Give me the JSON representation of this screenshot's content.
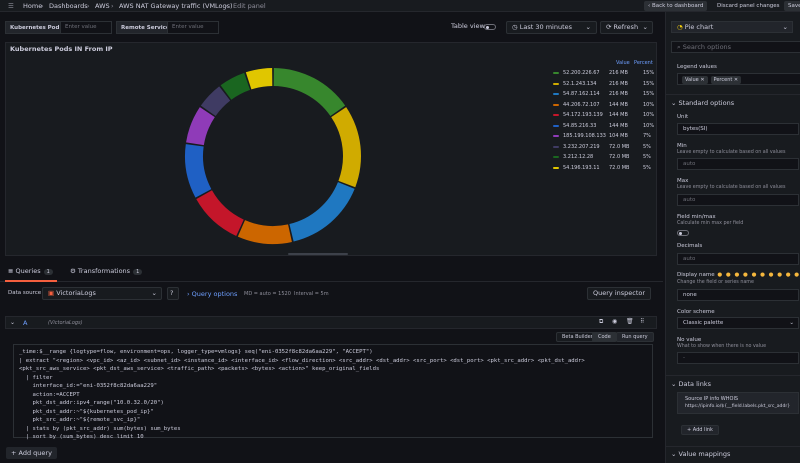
{
  "breadcrumb": {
    "home": "Home",
    "dashboards": "Dashboards",
    "folder": "AWS",
    "dashboard": "AWS NAT Gateway traffic (VMLogs)",
    "current": "Edit panel"
  },
  "topbar": {
    "back": "Back to dashboard",
    "discard": "Discard panel changes",
    "save": "Save"
  },
  "variables": [
    {
      "label": "Kubernetes Pod IP",
      "placeholder": "Enter value"
    },
    {
      "label": "Remote Service IP",
      "placeholder": "Enter value"
    }
  ],
  "toolbar": {
    "table_view": "Table view",
    "time_range": "Last 30 minutes",
    "refresh": "Refresh"
  },
  "panel": {
    "title": "Kubernetes Pods IN From IP",
    "legend_headers": {
      "value": "Value",
      "percent": "Percent"
    }
  },
  "chart_data": {
    "type": "pie",
    "donut": true,
    "slices": [
      {
        "name": "52.200.226.67",
        "value": "216 MB",
        "percent": 15,
        "color": "#37872d"
      },
      {
        "name": "52.1.243.134",
        "value": "216 MB",
        "percent": 15,
        "color": "#d0ab00"
      },
      {
        "name": "54.87.162.114",
        "value": "216 MB",
        "percent": 15,
        "color": "#1f78c1"
      },
      {
        "name": "44.206.72.107",
        "value": "144 MB",
        "percent": 10,
        "color": "#cc6600"
      },
      {
        "name": "54.172.193.139",
        "value": "144 MB",
        "percent": 10,
        "color": "#c4162a"
      },
      {
        "name": "54.85.216.33",
        "value": "144 MB",
        "percent": 10,
        "color": "#1f60c4"
      },
      {
        "name": "185.199.108.133",
        "value": "104 MB",
        "percent": 7,
        "color": "#8f3bb8"
      },
      {
        "name": "3.232.207.219",
        "value": "72.0 MB",
        "percent": 5,
        "color": "#3f3b63"
      },
      {
        "name": "3.212.12.28",
        "value": "72.0 MB",
        "percent": 5,
        "color": "#1a6620"
      },
      {
        "name": "54.196.193.11",
        "value": "72.0 MB",
        "percent": 5,
        "color": "#e0c600"
      }
    ]
  },
  "query_tabs": {
    "queries": "Queries",
    "queries_count": "1",
    "transformations": "Transformations",
    "transformations_count": "1"
  },
  "datasource": {
    "label": "Data source",
    "name": "VictoriaLogs",
    "query_options": "Query options",
    "meta": "MD = auto = 1520",
    "interval": "Interval = 5m",
    "inspector": "Query inspector"
  },
  "query": {
    "ref": "A",
    "ds": "(VictoriaLogs)",
    "builder": "Beta Builder",
    "code": "Code",
    "run": "Run query",
    "lines": [
      "_time:$__range {logtype=flow, environment=ops, logger_type=vmlogs} seq(\"eni-0352f8c82da6aa229\", \"ACCEPT\")",
      "| extract \"<region> <vpc_id> <az_id> <subnet_id> <instance_id> <interface_id> <flow_direction> <src_addr> <dst_addr> <src_port> <dst_port> <pkt_src_addr> <pkt_dst_addr>",
      "<pkt_src_aws_service> <pkt_dst_aws_service> <traffic_path> <packets> <bytes> <action>\" keep_original_fields",
      "  | filter",
      "    interface_id:=\"eni-0352f8c82da6aa229\"",
      "    action:=ACCEPT",
      "    pkt_dst_addr:ipv4_range(\"10.0.32.0/20\")",
      "    pkt_dst_addr:~\"${kubernetes_pod_ip}\"",
      "    pkt_src_addr:~\"${remote_svc_ip}\"",
      "  | stats by (pkt_src_addr) sum(bytes) sum_bytes",
      "  | sort by (sum_bytes) desc limit 10"
    ]
  },
  "add_query": "Add query",
  "options": {
    "viz": "Pie chart",
    "search_placeholder": "Search options",
    "legend_values": "Legend values",
    "chips": [
      "Value",
      "Percent"
    ],
    "standard_options": "Standard options",
    "unit_label": "Unit",
    "unit_value": "bytes(SI)",
    "min_label": "Min",
    "min_desc": "Leave empty to calculate based on all values",
    "min_value": "auto",
    "max_label": "Max",
    "max_desc": "Leave empty to calculate based on all values",
    "max_value": "auto",
    "fieldminmax_label": "Field min/max",
    "fieldminmax_desc": "Calculate min max per field",
    "decimals_label": "Decimals",
    "decimals_value": "auto",
    "displayname_label": "Display name",
    "displayname_desc": "Change the field or series name",
    "displayname_value": "none",
    "colorscheme_label": "Color scheme",
    "colorscheme_value": "Classic palette",
    "novalue_label": "No value",
    "novalue_desc": "What to show when there is no value",
    "novalue_value": "-",
    "datalinks": "Data links",
    "link_title": "Source IP info WHOIS",
    "link_url": "https://ipinfo.io/${__field.labels.pkt_src_addr}",
    "add_link": "Add link",
    "value_mappings": "Value mappings"
  }
}
